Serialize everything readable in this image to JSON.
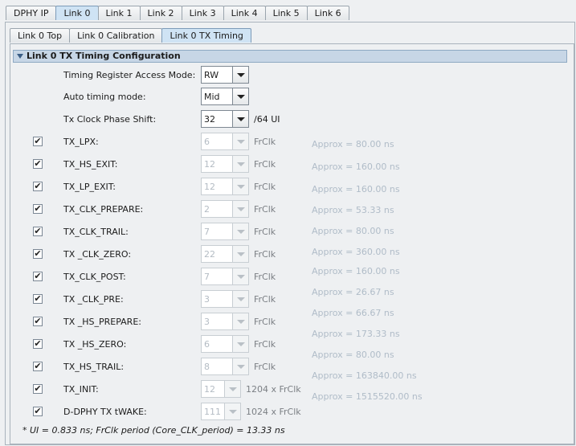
{
  "top_tabs": [
    "DPHY IP",
    "Link 0",
    "Link 1",
    "Link 2",
    "Link 3",
    "Link 4",
    "Link 5",
    "Link 6"
  ],
  "sub_tabs": [
    "Link 0 Top",
    "Link 0 Calibration",
    "Link 0 TX Timing"
  ],
  "section_title": "Link 0 TX Timing Configuration",
  "access_mode": {
    "label": "Timing Register Access Mode:",
    "value": "RW"
  },
  "auto_timing": {
    "label": "Auto timing mode:",
    "value": "Mid"
  },
  "phase_shift": {
    "label": "Tx Clock Phase Shift:",
    "value": "32",
    "unit": "/64 UI"
  },
  "params": [
    {
      "label": "TX_LPX:",
      "value": "6",
      "unit": "FrClk",
      "approx": "Approx = 80.00 ns"
    },
    {
      "label": "TX_HS_EXIT:",
      "value": "12",
      "unit": "FrClk",
      "approx": "Approx = 160.00 ns"
    },
    {
      "label": "TX_LP_EXIT:",
      "value": "12",
      "unit": "FrClk",
      "approx": "Approx = 160.00 ns"
    },
    {
      "label": "TX_CLK_PREPARE:",
      "value": "2",
      "unit": "FrClk",
      "approx": "Approx = 53.33 ns"
    },
    {
      "label": "TX_CLK_TRAIL:",
      "value": "7",
      "unit": "FrClk",
      "approx": "Approx = 80.00 ns"
    },
    {
      "label": "TX _CLK_ZERO:",
      "value": "22",
      "unit": "FrClk",
      "approx": "Approx = 360.00 ns"
    },
    {
      "label": "TX_CLK_POST:",
      "value": "7",
      "unit": "FrClk",
      "approx": "Approx = 160.00 ns"
    },
    {
      "label": "TX _CLK_PRE:",
      "value": "3",
      "unit": "FrClk",
      "approx": "Approx = 26.67 ns"
    },
    {
      "label": "TX _HS_PREPARE:",
      "value": "3",
      "unit": "FrClk",
      "approx": "Approx = 66.67 ns"
    },
    {
      "label": "TX _HS_ZERO:",
      "value": "6",
      "unit": "FrClk",
      "approx": "Approx = 173.33 ns"
    },
    {
      "label": "TX_HS_TRAIL:",
      "value": "8",
      "unit": "FrClk",
      "approx": "Approx = 80.00 ns"
    },
    {
      "label": "TX_INIT:",
      "value": "12",
      "unit": "1204 x FrClk",
      "approx": "Approx = 163840.00 ns"
    },
    {
      "label": "D-DPHY TX tWAKE:",
      "value": "111",
      "unit": "1024 x FrClk",
      "approx": "Approx = 1515520.00 ns"
    }
  ],
  "footnote": "* UI = 0.833 ns; FrClk period (Core_CLK_period) = 13.33 ns"
}
